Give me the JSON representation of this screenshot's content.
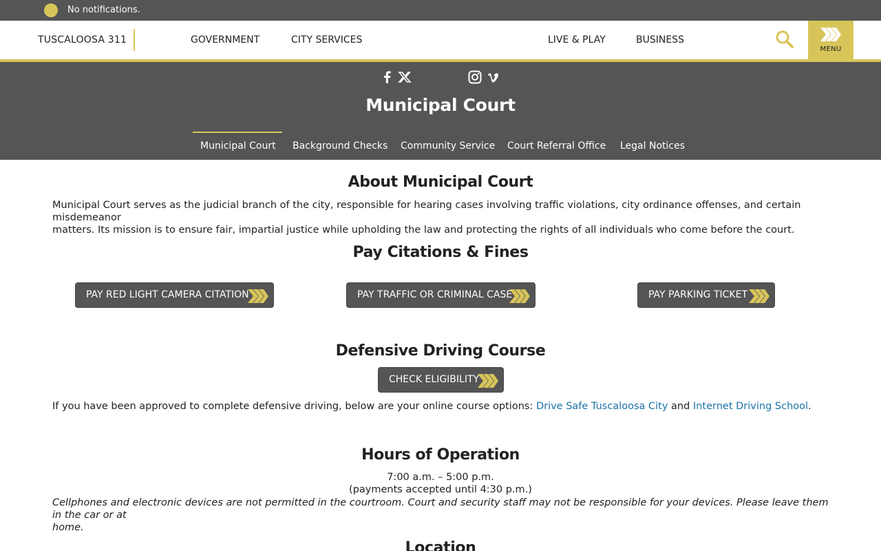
{
  "notification": {
    "text": "No notifications."
  },
  "header": {
    "brand": "TUSCALOOSA 311",
    "nav": [
      "GOVERNMENT",
      "CITY SERVICES",
      "LIVE & PLAY",
      "BUSINESS"
    ],
    "menu_label": "MENU",
    "icons": [
      "search-icon",
      "menu-chevrons-icon"
    ]
  },
  "colors": {
    "accent": "#d8c55a",
    "dark": "#555555",
    "link": "#1a73a8"
  },
  "hero": {
    "social_icons": [
      "facebook-icon",
      "x-icon",
      "instagram-icon",
      "vimeo-icon"
    ],
    "title": "Municipal Court",
    "subnav": [
      "Municipal Court",
      "Background Checks",
      "Community Service",
      "Court Referral Office",
      "Legal Notices"
    ],
    "active_subnav": "Municipal Court"
  },
  "about": {
    "title": "About Municipal Court",
    "line1": "Municipal Court serves as the judicial branch of the city, responsible for hearing cases involving traffic violations, city ordinance offenses, and certain misdemeanor",
    "line2": "matters. Its mission is to ensure fair, impartial justice while upholding the law and protecting the rights of all individuals who come before the court."
  },
  "pay": {
    "title": "Pay Citations & Fines",
    "buttons": [
      "PAY RED LIGHT CAMERA CITATION",
      "PAY TRAFFIC OR CRIMINAL CASE",
      "PAY PARKING TICKET"
    ]
  },
  "defensive": {
    "title": "Defensive Driving Course",
    "button": "CHECK ELIGIBILITY",
    "text_before": "If you have been approved to complete defensive driving, below are your online course options: ",
    "link1": "Drive Safe Tuscaloosa City",
    "text_mid": " and ",
    "link2": "Internet Driving School",
    "text_after": "."
  },
  "hours": {
    "title": "Hours of Operation",
    "line1": "7:00 a.m. – 5:00 p.m.",
    "line2": "(payments accepted until 4:30 p.m.)",
    "note1": "Cellphones and electronic devices are not permitted in the courtroom. Court and security staff may not be responsible for your devices. Please leave them in the car or at",
    "note2": "home."
  },
  "location": {
    "title": "Location"
  }
}
